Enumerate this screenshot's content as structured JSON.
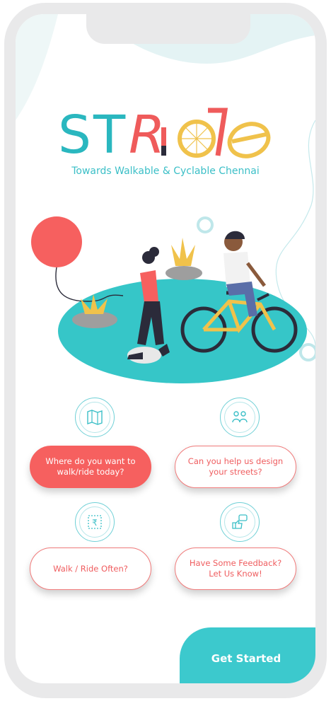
{
  "app": {
    "logo_text": "STRide",
    "tagline": "Towards Walkable & Cyclable Chennai"
  },
  "options": [
    {
      "label": "Where do you want to walk/ride today?",
      "icon": "map-icon",
      "style": "filled"
    },
    {
      "label": "Can you help us design your streets?",
      "icon": "people-design-icon",
      "style": "outline"
    },
    {
      "label": "Walk / Ride Often?",
      "icon": "rupee-ticket-icon",
      "style": "outline"
    },
    {
      "label": "Have Some Feedback? Let Us Know!",
      "icon": "feedback-thumbs-icon",
      "style": "outline"
    }
  ],
  "cta": {
    "label": "Get Started"
  },
  "colors": {
    "teal": "#3cc9cd",
    "coral": "#f6605f",
    "yellow": "#f0c24b",
    "dark": "#2b2b3a"
  }
}
